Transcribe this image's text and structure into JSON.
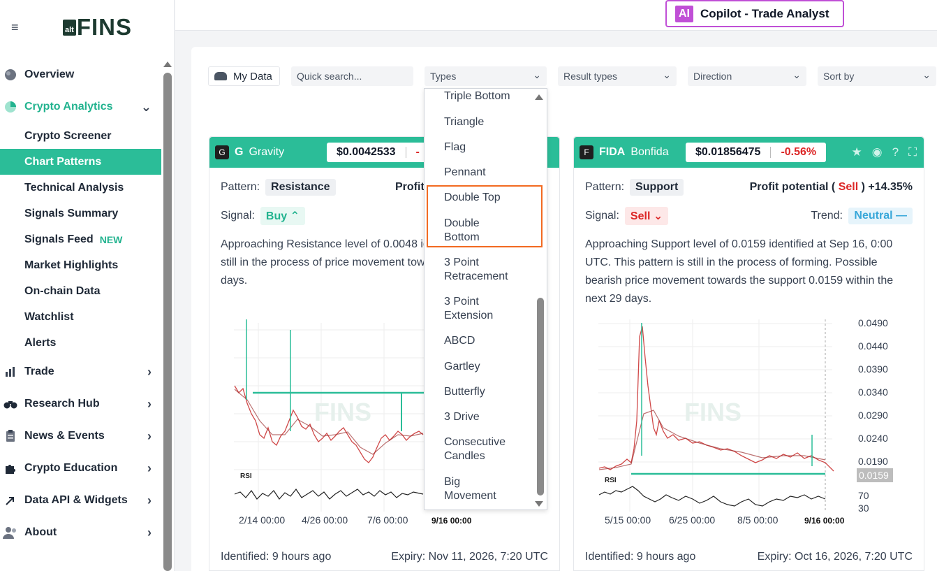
{
  "sidebar": {
    "logo_alt": "alt",
    "logo_fins": "FINS",
    "items": [
      {
        "label": "Overview"
      },
      {
        "label": "Crypto Analytics"
      },
      {
        "label": "Trade"
      },
      {
        "label": "Research Hub"
      },
      {
        "label": "News & Events"
      },
      {
        "label": "Crypto Education"
      },
      {
        "label": "Data API & Widgets"
      },
      {
        "label": "About"
      }
    ],
    "sub_items": [
      {
        "label": "Crypto Screener"
      },
      {
        "label": "Chart Patterns"
      },
      {
        "label": "Technical Analysis"
      },
      {
        "label": "Signals Summary"
      },
      {
        "label": "Signals Feed"
      },
      {
        "label": "Market Highlights"
      },
      {
        "label": "On-chain Data"
      },
      {
        "label": "Watchlist"
      },
      {
        "label": "Alerts"
      }
    ],
    "new_badge": "NEW"
  },
  "copilot": {
    "ai": "AI",
    "label": "Copilot - Trade Analyst",
    "color": "#c04fd6"
  },
  "filters": {
    "my_data": "My Data",
    "search_placeholder": "Quick search...",
    "types": "Types",
    "result_types": "Result types",
    "direction": "Direction",
    "sort_by": "Sort by"
  },
  "dropdown": {
    "options": [
      "Triple Bottom",
      "Triangle",
      "Flag",
      "Pennant",
      "Double Top",
      "Double\nBottom",
      "3 Point\nRetracement",
      "3 Point\nExtension",
      "ABCD",
      "Gartley",
      "Butterfly",
      "3 Drive",
      "Consecutive\nCandles",
      "Big\nMovement"
    ],
    "highlighted": [
      "Double Top",
      "Double Bottom"
    ],
    "highlight_color": "#f26a21"
  },
  "cards": [
    {
      "icon": "G",
      "symbol": "G",
      "name": "Gravity",
      "price": "$0.0042533",
      "change": "-",
      "pattern_label": "Pattern:",
      "pattern": "Resistance",
      "profit": "Profit",
      "profit_tail": "%",
      "signal_label": "Signal:",
      "signal": "Buy",
      "description": "Approaching Resistance level of 0.0048 id UTC. This pattern is still in the process of price movement towards the resistance 0. days.",
      "chart_labels": {
        "rsi": "RSI",
        "watermark": "FINS"
      },
      "x_ticks": [
        "2/14 00:00",
        "4/26 00:00",
        "7/6 00:00",
        "9/16 00:00"
      ],
      "identified": "Identified: 9 hours ago",
      "expiry": "Expiry: Nov 11, 2026, 7:20 UTC"
    },
    {
      "icon": "F",
      "symbol": "FIDA",
      "name": "Bonfida",
      "price": "$0.01856475",
      "change": "-0.56%",
      "pattern_label": "Pattern:",
      "pattern": "Support",
      "profit": "Profit potential (",
      "profit_dir": "Sell",
      "profit_value": ") +14.35%",
      "signal_label": "Signal:",
      "signal": "Sell",
      "trend_label": "Trend:",
      "trend": "Neutral",
      "description": "Approaching Support level of 0.0159 identified at Sep 16, 0:00 UTC. This pattern is still in the process of forming. Possible bearish price movement towards the support 0.0159 within the next 29 days.",
      "chart_labels": {
        "rsi": "RSI",
        "watermark": "FINS",
        "level": "0.0159"
      },
      "y_ticks": [
        "0.0490",
        "0.0440",
        "0.0390",
        "0.0340",
        "0.0290",
        "0.0240",
        "0.0190"
      ],
      "rsi_ticks": [
        "70",
        "30"
      ],
      "x_ticks": [
        "5/15 00:00",
        "6/25 00:00",
        "8/5 00:00",
        "9/16 00:00"
      ],
      "identified": "Identified: 9 hours ago",
      "expiry": "Expiry: Oct 16, 2026, 7:20 UTC"
    }
  ],
  "colors": {
    "accent": "#2bbd98",
    "sell": "#dc2626",
    "buy": "#22b38f",
    "neutral": "#38a7d9"
  }
}
